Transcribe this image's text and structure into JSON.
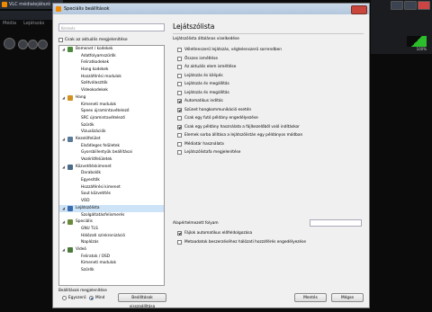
{
  "vlc": {
    "title": "VLC médialejátszó",
    "menu": [
      "Média",
      "Lejátszás"
    ],
    "volume": "100%"
  },
  "dialog": {
    "title": "Speciális beállítások",
    "search_placeholder": "Keresés",
    "only_current": "Csak az aktuális megjelenítése",
    "prefs_label": "Beállítások megjelenítése",
    "radio_simple": "Egyszerű",
    "radio_all": "Mind",
    "reset_button": "Beállítások visszaállítása",
    "save_button": "Mentés",
    "cancel_button": "Mégse"
  },
  "tree": [
    {
      "label": "Bemenet / kodekek",
      "level": 0,
      "icon": "input-codecs-icon",
      "color": "#4a8a3a",
      "expanded": true
    },
    {
      "label": "Adatfolyamszűrők",
      "level": 1
    },
    {
      "label": "Feliratkodekek",
      "level": 1
    },
    {
      "label": "Hang kodekek",
      "level": 1
    },
    {
      "label": "Hozzáférési modulok",
      "level": 1
    },
    {
      "label": "Szétválasztók",
      "level": 1
    },
    {
      "label": "Videokodekek",
      "level": 1
    },
    {
      "label": "Hang",
      "level": 0,
      "icon": "audio-icon",
      "color": "#d49020",
      "expanded": true
    },
    {
      "label": "Kimeneti modulok",
      "level": 1
    },
    {
      "label": "Speex újramintavételező",
      "level": 1
    },
    {
      "label": "SRC újramintavételező",
      "level": 1
    },
    {
      "label": "Szűrők",
      "level": 1
    },
    {
      "label": "Vizualizációk",
      "level": 1
    },
    {
      "label": "Kezelőfelület",
      "level": 0,
      "icon": "interface-icon",
      "color": "#5a7a9a",
      "expanded": true
    },
    {
      "label": "Elsődleges felületek",
      "level": 1
    },
    {
      "label": "Gyorsbillentyűk beállításai",
      "level": 1
    },
    {
      "label": "Vezérlőfelületek",
      "level": 1
    },
    {
      "label": "Közvetítéskimenet",
      "level": 0,
      "icon": "stream-output-icon",
      "color": "#4a6a8a",
      "expanded": true
    },
    {
      "label": "Darabolók",
      "level": 1
    },
    {
      "label": "Egyesítők",
      "level": 1
    },
    {
      "label": "Hozzáférési kimenet",
      "level": 1
    },
    {
      "label": "Sout közvetítés",
      "level": 1
    },
    {
      "label": "VOD",
      "level": 1
    },
    {
      "label": "Lejátszólista",
      "level": 0,
      "icon": "playlist-icon",
      "color": "#3a6ab0",
      "expanded": true,
      "selected": true
    },
    {
      "label": "Szolgáltatásfelismerés",
      "level": 1
    },
    {
      "label": "Speciális",
      "level": 0,
      "icon": "advanced-icon",
      "color": "#6a8a3a",
      "expanded": true
    },
    {
      "label": "GNU TLS",
      "level": 1
    },
    {
      "label": "Hálózati szinkronizáció",
      "level": 1
    },
    {
      "label": "Naplózás",
      "level": 1
    },
    {
      "label": "Videó",
      "level": 0,
      "icon": "video-icon",
      "color": "#4a7a3a",
      "expanded": true
    },
    {
      "label": "Feliratok / OSD",
      "level": 1
    },
    {
      "label": "Kimeneti modulok",
      "level": 1
    },
    {
      "label": "Szűrők",
      "level": 1
    }
  ],
  "panel": {
    "title": "Lejátszólista",
    "general": "Lejátszólista általános viselkedése",
    "options": [
      {
        "label": "Véletlenszerű lejátszás, végtelenszerű sorrendben",
        "checked": false
      },
      {
        "label": "Összes ismétlése",
        "checked": false
      },
      {
        "label": "Az aktuális elem ismétlése",
        "checked": false
      },
      {
        "label": "Lejátszás és kilépés",
        "checked": false
      },
      {
        "label": "Lejátszás és megállítás",
        "checked": false
      },
      {
        "label": "Lejátszás és megállítás",
        "checked": false
      },
      {
        "label": "Automatikus indítás",
        "checked": true
      },
      {
        "label": "Szünet hangkommunikáció esetén",
        "checked": true
      },
      {
        "label": "Csak egy futó példány engedélyezése",
        "checked": false
      },
      {
        "label": "Csak egy példány használata a fájlkezelőből való indításkor",
        "checked": true
      },
      {
        "label": "Elemek sorba állítása a lejátszólistán egy példányos módban",
        "checked": false
      },
      {
        "label": "Médiatár használata",
        "checked": false
      },
      {
        "label": "Lejátszólistafa megjelenítése",
        "checked": false
      }
    ],
    "autostart_label": "Alapértelmezett folyam",
    "options2": [
      {
        "label": "Fájlok automatikus előfeldolgozása",
        "checked": true
      },
      {
        "label": "Metaadatok beszerzéséhez hálózati hozzáférés engedélyezése",
        "checked": false
      }
    ]
  }
}
